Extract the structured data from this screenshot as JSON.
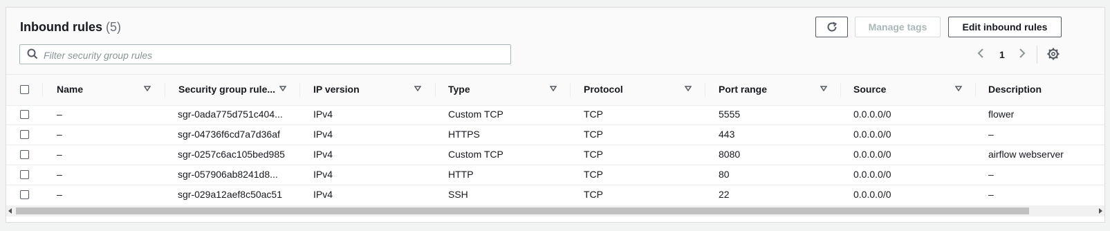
{
  "header": {
    "title": "Inbound rules",
    "count": "(5)",
    "manage_tags_label": "Manage tags",
    "edit_label": "Edit inbound rules"
  },
  "search": {
    "placeholder": "Filter security group rules"
  },
  "pagination": {
    "current_page": "1"
  },
  "icons": {
    "refresh": "refresh-icon",
    "search": "search-icon",
    "prev": "chevron-left-icon",
    "next": "chevron-right-icon",
    "settings": "gear-icon",
    "sort": "caret-down-icon"
  },
  "columns": [
    "Name",
    "Security group rule...",
    "IP version",
    "Type",
    "Protocol",
    "Port range",
    "Source",
    "Description"
  ],
  "rows": [
    [
      "–",
      "sgr-0ada775d751c404...",
      "IPv4",
      "Custom TCP",
      "TCP",
      "5555",
      "0.0.0.0/0",
      "flower"
    ],
    [
      "–",
      "sgr-04736f6cd7a7d36af",
      "IPv4",
      "HTTPS",
      "TCP",
      "443",
      "0.0.0.0/0",
      "–"
    ],
    [
      "–",
      "sgr-0257c6ac105bed985",
      "IPv4",
      "Custom TCP",
      "TCP",
      "8080",
      "0.0.0.0/0",
      "airflow webserver"
    ],
    [
      "–",
      "sgr-057906ab8241d8...",
      "IPv4",
      "HTTP",
      "TCP",
      "80",
      "0.0.0.0/0",
      "–"
    ],
    [
      "–",
      "sgr-029a12aef8c50ac51",
      "IPv4",
      "SSH",
      "TCP",
      "22",
      "0.0.0.0/0",
      "–"
    ]
  ],
  "colors": {
    "border": "#dadcdd",
    "text": "#16191f",
    "muted": "#687078",
    "disabled": "#aab7b8"
  }
}
